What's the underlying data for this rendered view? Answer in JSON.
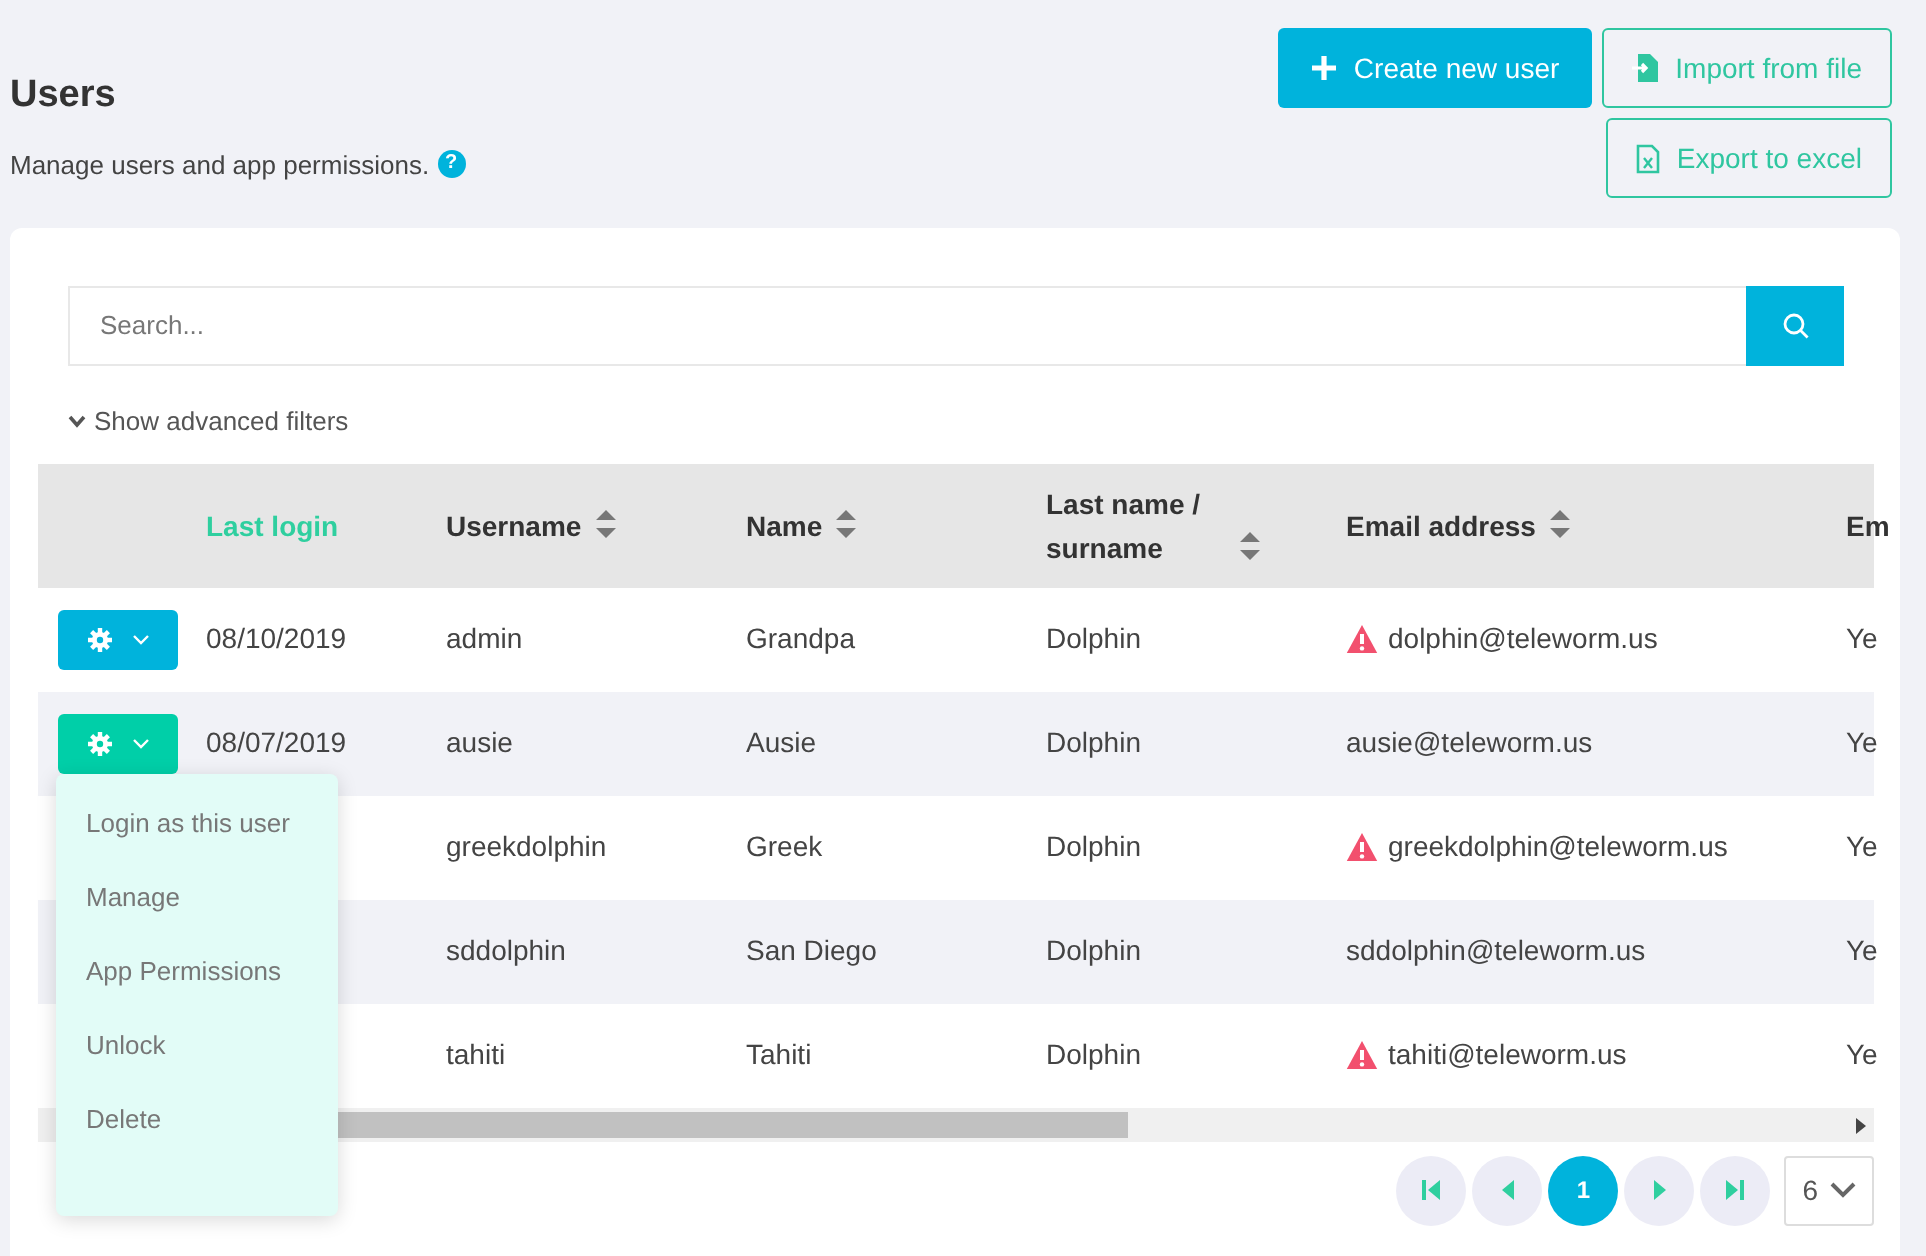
{
  "header": {
    "title": "Users",
    "subtitle": "Manage users and app permissions.",
    "help": "?"
  },
  "actions": [
    {
      "label": "Create new user",
      "kind": "primary"
    },
    {
      "label": "Import from file",
      "kind": "import"
    },
    {
      "label": "Export to excel",
      "kind": "export"
    }
  ],
  "search": {
    "placeholder": "Search..."
  },
  "filters_toggle": {
    "label": "Show advanced filters",
    "expanded": false
  },
  "table": {
    "columns": [
      {
        "label": "Last login",
        "sorted": true,
        "sort_icon": false
      },
      {
        "label": "Username",
        "sorted": false,
        "sort_icon": true
      },
      {
        "label": "Name",
        "sorted": false,
        "sort_icon": true
      },
      {
        "label": "Last name / surname",
        "sorted": false,
        "sort_icon": true
      },
      {
        "label": "Email address",
        "sorted": false,
        "sort_icon": true
      },
      {
        "label": "Em",
        "sorted": false,
        "sort_icon": false
      }
    ],
    "rows": [
      {
        "menu_open": false,
        "last_login": "08/10/2019",
        "username": "admin",
        "name": "Grandpa",
        "last_name": "Dolphin",
        "email": "dolphin@teleworm.us",
        "email_warning": true,
        "column_7": "Ye"
      },
      {
        "menu_open": true,
        "last_login": "08/07/2019",
        "username": "ausie",
        "name": "Ausie",
        "last_name": "Dolphin",
        "email": "ausie@teleworm.us",
        "email_warning": false,
        "column_7": "Ye"
      },
      {
        "username": "greekdolphin",
        "name": "Greek",
        "last_name": "Dolphin",
        "email": "greekdolphin@teleworm.us",
        "email_warning": true,
        "column_7": "Ye"
      },
      {
        "username": "sddolphin",
        "name": "San Diego",
        "last_name": "Dolphin",
        "email": "sddolphin@teleworm.us",
        "email_warning": false,
        "column_7": "Ye"
      },
      {
        "username": "tahiti",
        "name": "Tahiti",
        "last_name": "Dolphin",
        "email": "tahiti@teleworm.us",
        "email_warning": true,
        "column_7": "Ye"
      }
    ]
  },
  "row_menu": {
    "items": [
      "Login as this user",
      "Manage",
      "App Permissions",
      "Unlock",
      "Delete"
    ]
  },
  "pagination": {
    "pages": [
      {
        "label": "1",
        "selected": true
      }
    ],
    "page_size": "6"
  }
}
